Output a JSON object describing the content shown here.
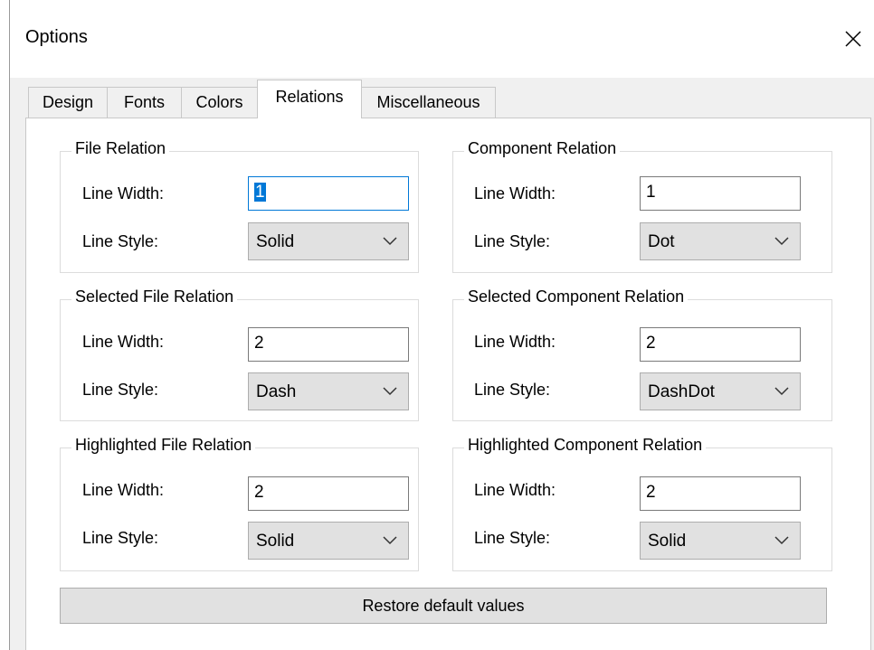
{
  "window": {
    "title": "Options"
  },
  "tabs": [
    {
      "label": "Design"
    },
    {
      "label": "Fonts"
    },
    {
      "label": "Colors"
    },
    {
      "label": "Relations",
      "active": true
    },
    {
      "label": "Miscellaneous"
    }
  ],
  "groups": {
    "file_relation": {
      "title": "File Relation",
      "width_label": "Line Width:",
      "width_value": "1",
      "style_label": "Line Style:",
      "style_value": "Solid"
    },
    "component_relation": {
      "title": "Component Relation",
      "width_label": "Line Width:",
      "width_value": "1",
      "style_label": "Line Style:",
      "style_value": "Dot"
    },
    "selected_file_relation": {
      "title": "Selected File Relation",
      "width_label": "Line Width:",
      "width_value": "2",
      "style_label": "Line Style:",
      "style_value": "Dash"
    },
    "selected_component_relation": {
      "title": "Selected Component Relation",
      "width_label": "Line Width:",
      "width_value": "2",
      "style_label": "Line Style:",
      "style_value": "DashDot"
    },
    "highlighted_file_relation": {
      "title": "Highlighted File Relation",
      "width_label": "Line Width:",
      "width_value": "2",
      "style_label": "Line Style:",
      "style_value": "Solid"
    },
    "highlighted_component_relation": {
      "title": "Highlighted Component Relation",
      "width_label": "Line Width:",
      "width_value": "2",
      "style_label": "Line Style:",
      "style_value": "Solid"
    }
  },
  "restore_button": {
    "label": "Restore default values"
  },
  "icons": {
    "close": "close-icon",
    "dropdown": "chevron-down-icon"
  },
  "colors": {
    "focus": "#0078d7",
    "dialog_bg": "#f0f0f0",
    "panel_bg": "#ffffff"
  }
}
